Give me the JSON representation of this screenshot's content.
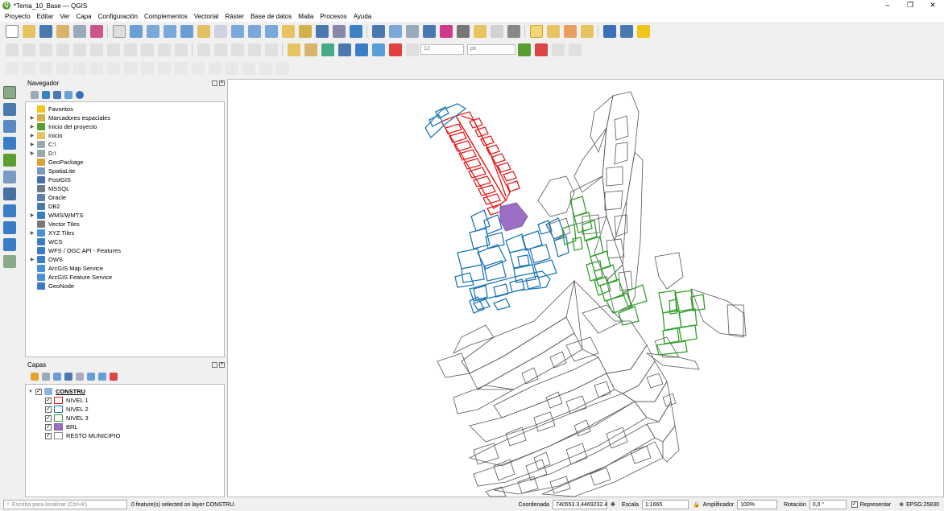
{
  "window": {
    "title": "*Tema_10_Base — QGIS",
    "minimize": "–",
    "maximize": "❐",
    "close": "✕"
  },
  "menu": [
    "Proyecto",
    "Editar",
    "Ver",
    "Capa",
    "Configuración",
    "Complementos",
    "Vectorial",
    "Ráster",
    "Base de datos",
    "Malla",
    "Procesos",
    "Ayuda"
  ],
  "toolbar": {
    "font_size": "12",
    "unit": "px"
  },
  "navigator": {
    "title": "Navegador",
    "items": [
      {
        "label": "Favoritos",
        "icon": "star-icon",
        "color": "#f0c419",
        "expand": false
      },
      {
        "label": "Marcadores espaciales",
        "icon": "bookmark-icon",
        "color": "#d4b04a",
        "expand": true
      },
      {
        "label": "Inicio del proyecto",
        "icon": "qgis-project-icon",
        "color": "#5a9e32",
        "expand": true
      },
      {
        "label": "Inicio",
        "icon": "folder-icon",
        "color": "#e8c460",
        "expand": true
      },
      {
        "label": "C:\\",
        "icon": "drive-icon",
        "color": "#9aa",
        "expand": true
      },
      {
        "label": "D:\\",
        "icon": "drive-icon",
        "color": "#9aa",
        "expand": true
      },
      {
        "label": "GeoPackage",
        "icon": "geopackage-icon",
        "color": "#d9a23a",
        "expand": false
      },
      {
        "label": "SpatiaLite",
        "icon": "spatialite-icon",
        "color": "#7a9ac4",
        "expand": false
      },
      {
        "label": "PostGIS",
        "icon": "postgis-icon",
        "color": "#4a6fa5",
        "expand": false
      },
      {
        "label": "MSSQL",
        "icon": "mssql-icon",
        "color": "#6c7b8b",
        "expand": false
      },
      {
        "label": "Oracle",
        "icon": "oracle-icon",
        "color": "#5b7ea6",
        "expand": false
      },
      {
        "label": "DB2",
        "icon": "db2-icon",
        "color": "#4a79b0",
        "expand": false
      },
      {
        "label": "WMS/WMTS",
        "icon": "globe-icon",
        "color": "#3b7dc4",
        "expand": true
      },
      {
        "label": "Vector Tiles",
        "icon": "grid-icon",
        "color": "#777",
        "expand": false
      },
      {
        "label": "XYZ Tiles",
        "icon": "tiles-icon",
        "color": "#4a90d9",
        "expand": true
      },
      {
        "label": "WCS",
        "icon": "globe-icon",
        "color": "#3b7dc4",
        "expand": false
      },
      {
        "label": "WFS / OGC API - Features",
        "icon": "globe-icon",
        "color": "#3b7dc4",
        "expand": false
      },
      {
        "label": "OWS",
        "icon": "globe-icon",
        "color": "#3b7dc4",
        "expand": true
      },
      {
        "label": "ArcGIS Map Service",
        "icon": "arcgis-icon",
        "color": "#4a90d9",
        "expand": false
      },
      {
        "label": "ArcGIS Feature Service",
        "icon": "arcgis-icon",
        "color": "#4a90d9",
        "expand": false
      },
      {
        "label": "GeoNode",
        "icon": "geonode-icon",
        "color": "#3b7dc4",
        "expand": false
      }
    ]
  },
  "layers": {
    "title": "Capas",
    "group": "CONSTRU",
    "items": [
      {
        "label": "NIVEL 1",
        "stroke": "#e31a1c",
        "fill": "#ffffff"
      },
      {
        "label": "NIVEL 2",
        "stroke": "#1f78b4",
        "fill": "#ffffff"
      },
      {
        "label": "NIVEL 3",
        "stroke": "#33a02c",
        "fill": "#ffffff"
      },
      {
        "label": "BRL",
        "stroke": "#7b5ca8",
        "fill": "#9b6fc4"
      },
      {
        "label": "RESTO MUNICIPIO",
        "stroke": "#888888",
        "fill": "#ffffff"
      }
    ]
  },
  "map": {
    "colors": {
      "nivel1": "#e31a1c",
      "nivel2": "#1f78b4",
      "nivel3": "#33a02c",
      "brl": "#9b6fc4",
      "resto": "#555555"
    }
  },
  "status": {
    "locator_placeholder": "Escriba para localizar (Ctrl+K)",
    "message": "0 feature(s) selected on layer CONSTRU.",
    "coord_label": "Coordenada",
    "coord_value": "740553.3,4469232.4",
    "scale_label": "Escala",
    "scale_value": "1:1665",
    "magnifier_label": "Amplificador",
    "magnifier_value": "100%",
    "rotation_label": "Rotación",
    "rotation_value": "0,0 °",
    "render_label": "Representar",
    "crs": "EPSG:25830"
  }
}
